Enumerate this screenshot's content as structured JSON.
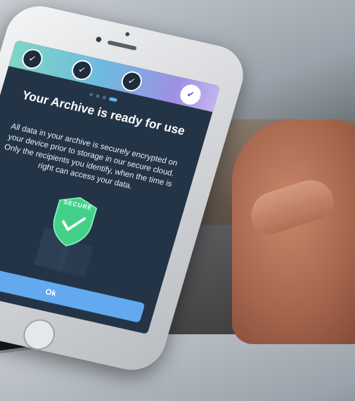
{
  "app": {
    "steps": [
      {
        "icon": "check-icon",
        "state": "done"
      },
      {
        "icon": "check-icon",
        "state": "done"
      },
      {
        "icon": "check-icon",
        "state": "done"
      },
      {
        "icon": "double-check-icon",
        "state": "current"
      }
    ],
    "pagination_active_index": 3,
    "title": "Your Archive is ready for use",
    "description": "All data in your archive is securely encrypted on your device prior to storage in our secure cloud. Only the recipients you identify, when the time is right can access your data.",
    "badge_label": "SECURE",
    "primary_button": "Ok"
  },
  "colors": {
    "screen_bg": "#243447",
    "accent": "#62a9ef",
    "shield": "#45d08a"
  }
}
